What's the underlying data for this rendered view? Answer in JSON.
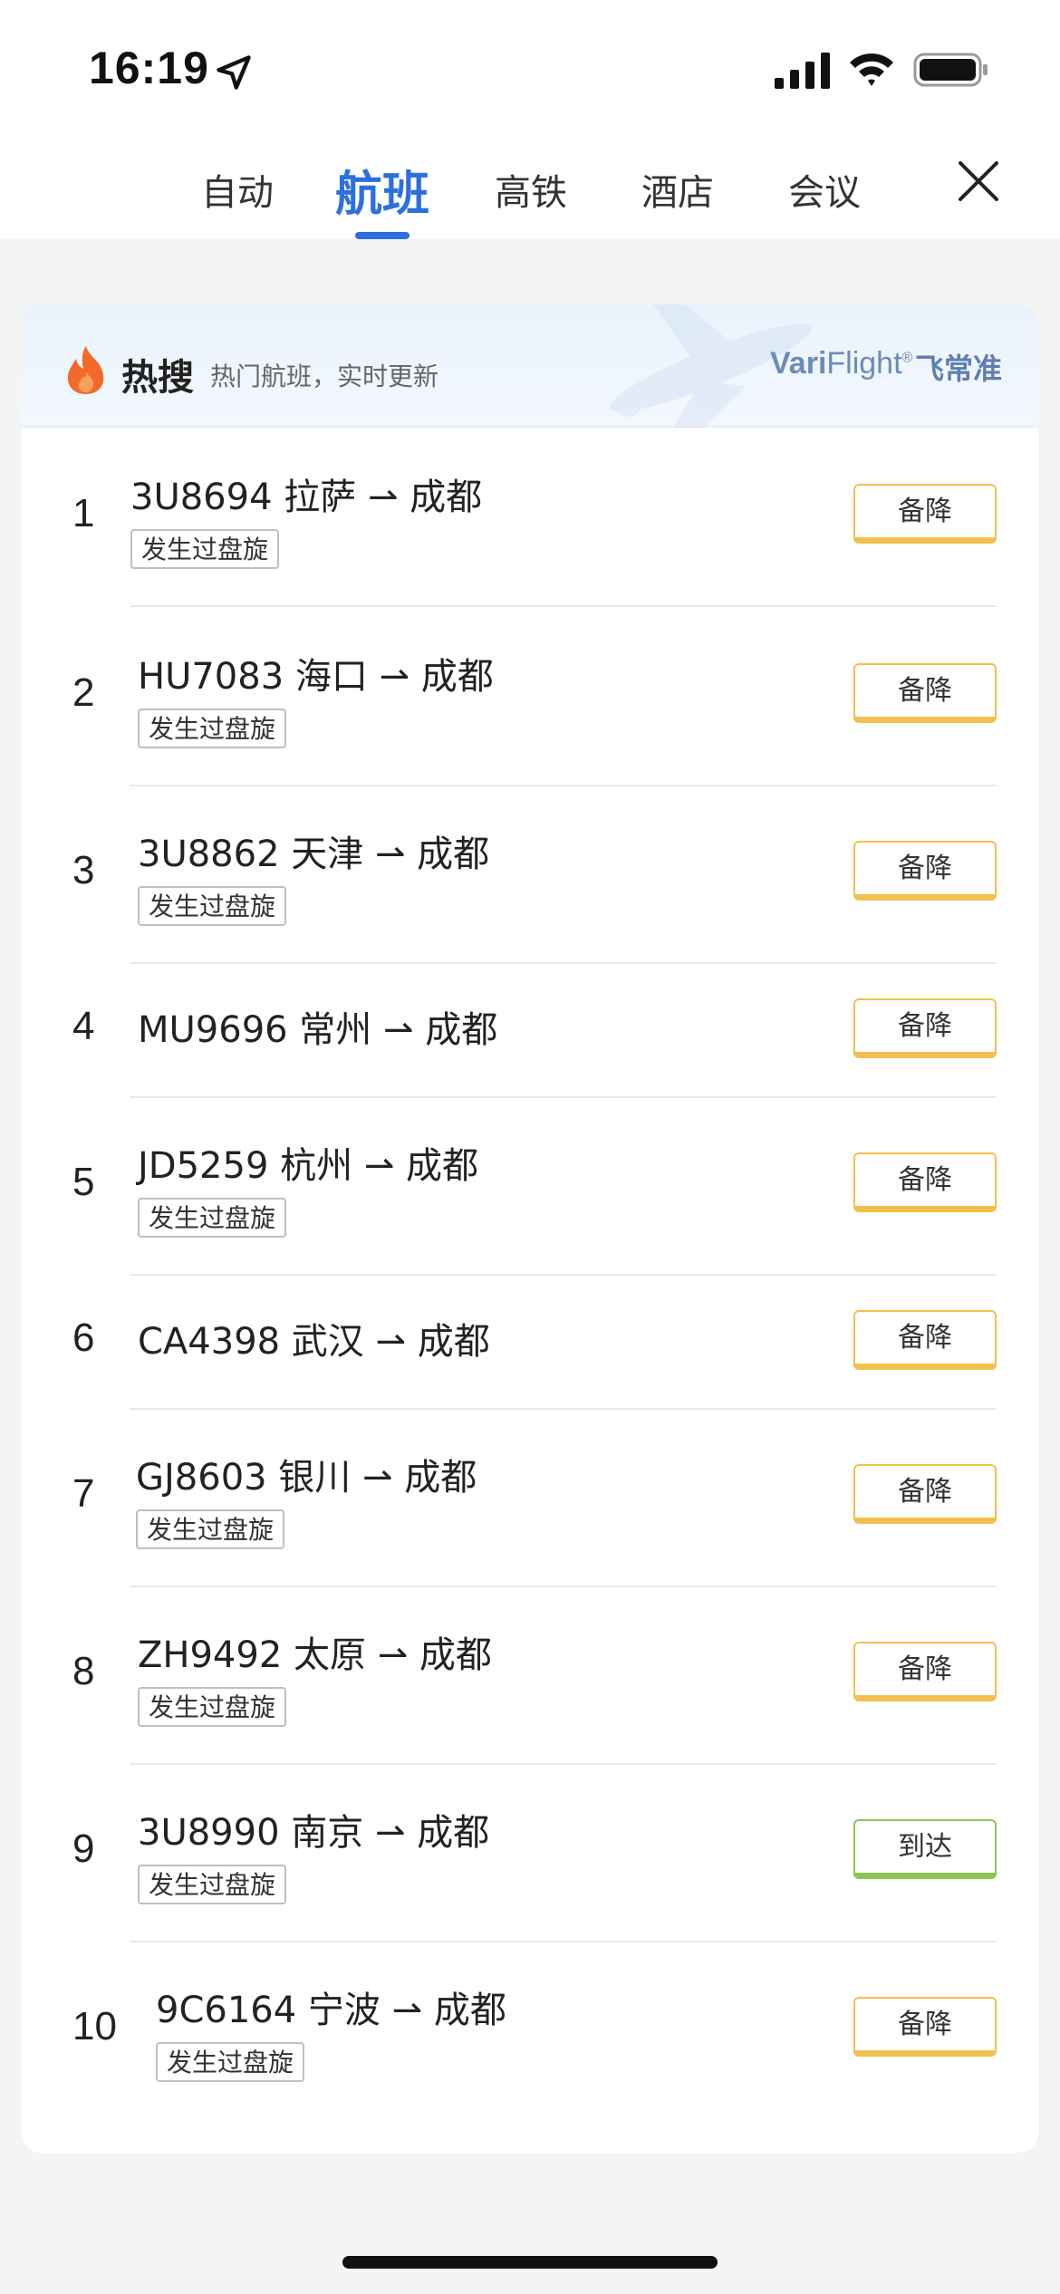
{
  "status_bar": {
    "time": "16:19"
  },
  "tabs": [
    {
      "label": "自动",
      "active": false
    },
    {
      "label": "航班",
      "active": true
    },
    {
      "label": "高铁",
      "active": false
    },
    {
      "label": "酒店",
      "active": false
    },
    {
      "label": "会议",
      "active": false
    }
  ],
  "header": {
    "title": "热搜",
    "subtitle": "热门航班，实时更新",
    "brand_bold": "Vari",
    "brand_rest": "Flight",
    "brand_mark": "®",
    "brand_cn": "飞常准"
  },
  "colors": {
    "accent": "#2d6fe0",
    "alternate": "#f2c04e",
    "arrived": "#8dc456",
    "fire": "#f26a2a"
  },
  "flights": [
    {
      "rank": "1",
      "text": "3U8694 拉萨 ⇀ 成都",
      "tag": "发生过盘旋",
      "status": "备降",
      "status_color": "yellow"
    },
    {
      "rank": "2",
      "text": "HU7083 海口 ⇀ 成都",
      "tag": "发生过盘旋",
      "status": "备降",
      "status_color": "yellow"
    },
    {
      "rank": "3",
      "text": "3U8862 天津 ⇀ 成都",
      "tag": "发生过盘旋",
      "status": "备降",
      "status_color": "yellow"
    },
    {
      "rank": "4",
      "text": "MU9696 常州 ⇀ 成都",
      "tag": "",
      "status": "备降",
      "status_color": "yellow"
    },
    {
      "rank": "5",
      "text": "JD5259 杭州 ⇀ 成都",
      "tag": "发生过盘旋",
      "status": "备降",
      "status_color": "yellow"
    },
    {
      "rank": "6",
      "text": "CA4398 武汉 ⇀ 成都",
      "tag": "",
      "status": "备降",
      "status_color": "yellow"
    },
    {
      "rank": "7",
      "text": "GJ8603 银川 ⇀ 成都",
      "tag": "发生过盘旋",
      "status": "备降",
      "status_color": "yellow"
    },
    {
      "rank": "8",
      "text": "ZH9492 太原 ⇀ 成都",
      "tag": "发生过盘旋",
      "status": "备降",
      "status_color": "yellow"
    },
    {
      "rank": "9",
      "text": "3U8990 南京 ⇀ 成都",
      "tag": "发生过盘旋",
      "status": "到达",
      "status_color": "green"
    },
    {
      "rank": "10",
      "text": "9C6164 宁波 ⇀ 成都",
      "tag": "发生过盘旋",
      "status": "备降",
      "status_color": "yellow"
    }
  ]
}
